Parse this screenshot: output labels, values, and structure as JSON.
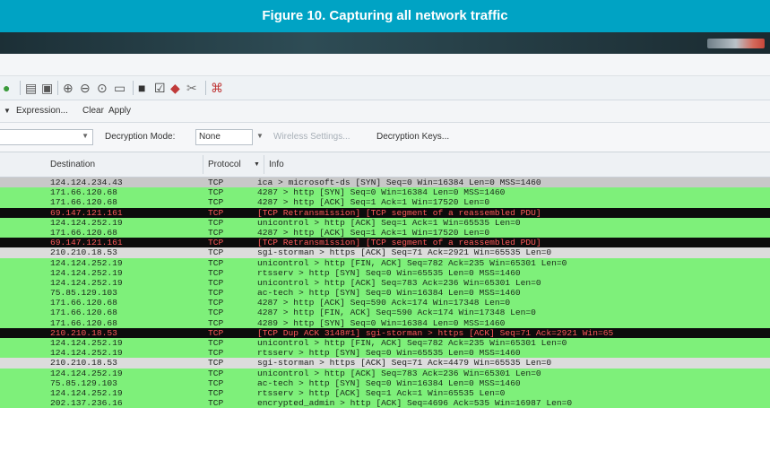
{
  "caption": "Figure 10. Capturing all network traffic",
  "colors": {
    "green": "#7ef07a",
    "gray": "#c8c8c8",
    "black": "#0c0c0c",
    "red_text": "#ff5a5a",
    "light": "#dcdcdc"
  },
  "toolbar": {
    "icons": [
      "user-icon",
      "capture-options-icon",
      "interfaces-icon",
      "zoom-in-icon",
      "zoom-out-icon",
      "zoom-normal-icon",
      "resize-columns-icon",
      "capture-filters-icon",
      "display-filters-icon",
      "coloring-rules-icon",
      "preferences-icon",
      "help-icon"
    ]
  },
  "filterbar": {
    "expression": "Expression...",
    "clear": "Clear",
    "apply": "Apply"
  },
  "wireless": {
    "decryption_mode_label": "Decryption Mode:",
    "decryption_mode_value": "None",
    "wireless_settings": "Wireless Settings...",
    "decryption_keys": "Decryption Keys..."
  },
  "columns": {
    "destination": "Destination",
    "protocol": "Protocol",
    "info": "Info"
  },
  "packets": [
    {
      "dst": "124.124.234.43",
      "proto": "TCP",
      "info": "ica > microsoft-ds [SYN] Seq=0 Win=16384 Len=0 MSS=1460",
      "style": "gray"
    },
    {
      "dst": "171.66.120.68",
      "proto": "TCP",
      "info": "4287 > http [SYN] Seq=0 Win=16384 Len=0 MSS=1460",
      "style": "green"
    },
    {
      "dst": "171.66.120.68",
      "proto": "TCP",
      "info": "4287 > http [ACK] Seq=1 Ack=1 Win=17520 Len=0",
      "style": "green"
    },
    {
      "dst": "69.147.121.161",
      "proto": "TCP",
      "info": "[TCP Retransmission] [TCP segment of a reassembled PDU]",
      "style": "black"
    },
    {
      "dst": "124.124.252.19",
      "proto": "TCP",
      "info": "unicontrol > http [ACK] Seq=1 Ack=1 Win=65535 Len=0",
      "style": "green"
    },
    {
      "dst": "171.66.120.68",
      "proto": "TCP",
      "info": "4287 > http [ACK] Seq=1 Ack=1 Win=17520 Len=0",
      "style": "green"
    },
    {
      "dst": "69.147.121.161",
      "proto": "TCP",
      "info": "[TCP Retransmission] [TCP segment of a reassembled PDU]",
      "style": "black"
    },
    {
      "dst": "210.210.18.53",
      "proto": "TCP",
      "info": "sgi-storman > https [ACK] Seq=71 Ack=2921 Win=65535 Len=0",
      "style": "light"
    },
    {
      "dst": "124.124.252.19",
      "proto": "TCP",
      "info": "unicontrol > http [FIN, ACK] Seq=782 Ack=235 Win=65301 Len=0",
      "style": "green"
    },
    {
      "dst": "124.124.252.19",
      "proto": "TCP",
      "info": "rtsserv > http [SYN] Seq=0 Win=65535 Len=0 MSS=1460",
      "style": "green"
    },
    {
      "dst": "124.124.252.19",
      "proto": "TCP",
      "info": "unicontrol > http [ACK] Seq=783 Ack=236 Win=65301 Len=0",
      "style": "green"
    },
    {
      "dst": "75.85.129.103",
      "proto": "TCP",
      "info": "ac-tech > http [SYN] Seq=0 Win=16384 Len=0 MSS=1460",
      "style": "green"
    },
    {
      "dst": "171.66.120.68",
      "proto": "TCP",
      "info": "4287 > http [ACK] Seq=590 Ack=174 Win=17348 Len=0",
      "style": "green"
    },
    {
      "dst": "171.66.120.68",
      "proto": "TCP",
      "info": "4287 > http [FIN, ACK] Seq=590 Ack=174 Win=17348 Len=0",
      "style": "green"
    },
    {
      "dst": "171.66.120.68",
      "proto": "TCP",
      "info": "4289 > http [SYN] Seq=0 Win=16384 Len=0 MSS=1460",
      "style": "green"
    },
    {
      "dst": "210.210.18.53",
      "proto": "TCP",
      "info": "[TCP Dup ACK 3148#1] sgi-storman > https [ACK] Seq=71 Ack=2921 Win=65",
      "style": "black"
    },
    {
      "dst": "124.124.252.19",
      "proto": "TCP",
      "info": "unicontrol > http [FIN, ACK] Seq=782 Ack=235 Win=65301 Len=0",
      "style": "green"
    },
    {
      "dst": "124.124.252.19",
      "proto": "TCP",
      "info": "rtsserv > http [SYN] Seq=0 Win=65535 Len=0 MSS=1460",
      "style": "green"
    },
    {
      "dst": "210.210.18.53",
      "proto": "TCP",
      "info": "sgi-storman > https [ACK] Seq=71 Ack=4479 Win=65535 Len=0",
      "style": "light"
    },
    {
      "dst": "124.124.252.19",
      "proto": "TCP",
      "info": "unicontrol > http [ACK] Seq=783 Ack=236 Win=65301 Len=0",
      "style": "green"
    },
    {
      "dst": "75.85.129.103",
      "proto": "TCP",
      "info": "ac-tech > http [SYN] Seq=0 Win=16384 Len=0 MSS=1460",
      "style": "green"
    },
    {
      "dst": "124.124.252.19",
      "proto": "TCP",
      "info": "rtsserv > http [ACK] Seq=1 Ack=1 Win=65535 Len=0",
      "style": "green"
    },
    {
      "dst": "202.137.236.16",
      "proto": "TCP",
      "info": "encrypted_admin > http [ACK] Seq=4696 Ack=535 Win=16987 Len=0",
      "style": "green"
    }
  ]
}
